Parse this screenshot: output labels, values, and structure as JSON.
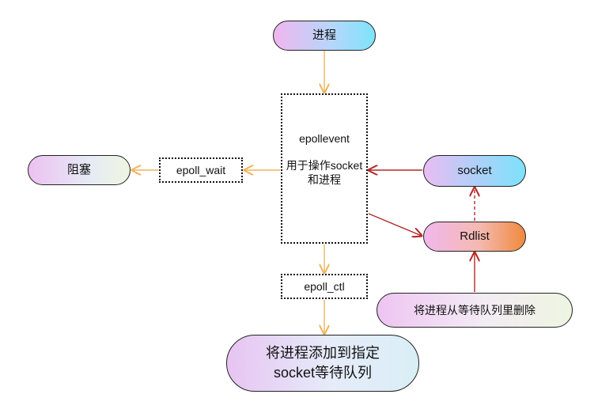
{
  "nodes": {
    "process": "进程",
    "block": "阻塞",
    "epollevent_title": "epollevent",
    "epollevent_desc": "用于操作socket和进程",
    "epoll_wait": "epoll_wait",
    "epoll_ctl": "epoll_ctl",
    "socket": "socket",
    "rdlist": "Rdlist",
    "remove_process": "将进程从等待队列里删除",
    "add_process_line1": "将进程添加到指定",
    "add_process_line2": "socket等待队列"
  },
  "colors": {
    "orange_arrow": "#f0b45c",
    "red_arrow": "#b42828"
  }
}
